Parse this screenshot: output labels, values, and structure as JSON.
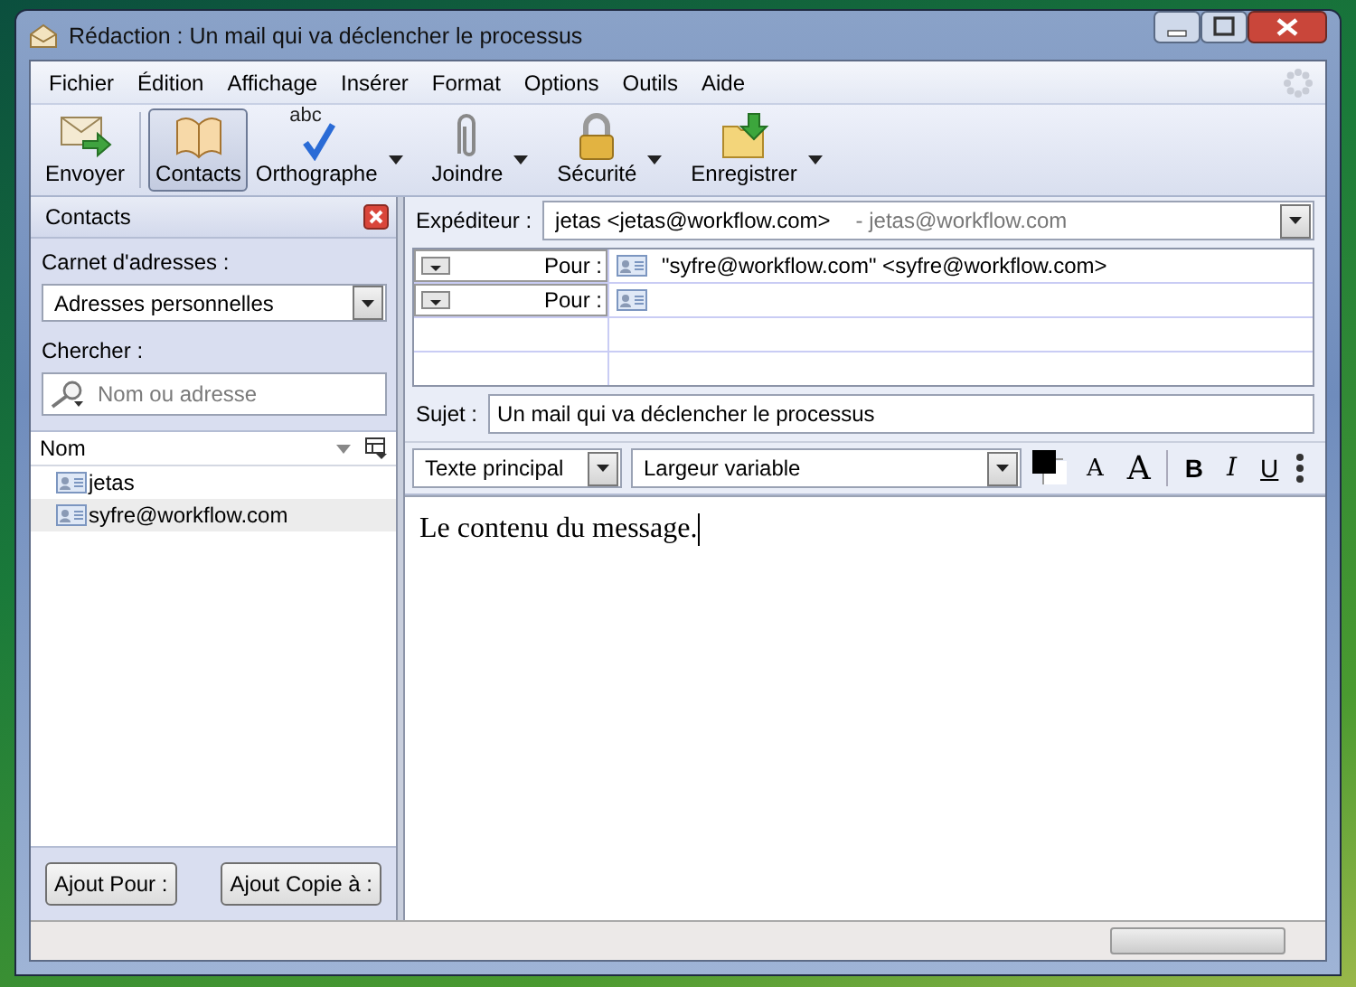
{
  "window": {
    "title": "Rédaction : Un mail qui va déclencher le processus"
  },
  "menu": [
    "Fichier",
    "Édition",
    "Affichage",
    "Insérer",
    "Format",
    "Options",
    "Outils",
    "Aide"
  ],
  "toolbar": [
    {
      "kind": "send",
      "label": "Envoyer",
      "selected": false,
      "dropdown": false
    },
    {
      "kind": "contacts",
      "label": "Contacts",
      "selected": true,
      "dropdown": false
    },
    {
      "kind": "spell",
      "label": "Orthographe",
      "icon_text": "abc",
      "selected": false,
      "dropdown": true
    },
    {
      "kind": "attach",
      "label": "Joindre",
      "selected": false,
      "dropdown": true
    },
    {
      "kind": "security",
      "label": "Sécurité",
      "selected": false,
      "dropdown": true
    },
    {
      "kind": "save",
      "label": "Enregistrer",
      "selected": false,
      "dropdown": true
    }
  ],
  "contacts_panel": {
    "title": "Contacts",
    "address_book_label": "Carnet d'adresses :",
    "address_book": "Adresses personnelles",
    "search_label": "Chercher :",
    "search": {
      "placeholder": "Nom ou adresse"
    },
    "column": "Nom",
    "contacts": [
      {
        "name": "jetas",
        "selected": false
      },
      {
        "name": "syfre@workflow.com",
        "selected": true
      }
    ],
    "buttons": [
      "Ajout Pour :",
      "Ajout Copie à :"
    ]
  },
  "compose": {
    "sender_label": "Expéditeur :",
    "sender": "jetas <jetas@workflow.com>",
    "sender_account": "- jetas@workflow.com",
    "recipients": [
      {
        "type": "Pour :",
        "address": "\"syfre@workflow.com\" <syfre@workflow.com>"
      },
      {
        "type": "Pour :"
      }
    ],
    "subject_label": "Sujet :",
    "subject": "Un mail qui va déclencher le processus"
  },
  "format_bar": {
    "paragraph_style": "Texte principal",
    "font": "Largeur variable",
    "buttons": [
      {
        "kind": "smaller",
        "label": "A"
      },
      {
        "kind": "larger",
        "label": "A"
      },
      {
        "kind": "bold",
        "label": "B"
      },
      {
        "kind": "italic",
        "label": "I"
      },
      {
        "kind": "underline",
        "label": "U"
      }
    ]
  },
  "body": "Le contenu du message.",
  "status_bar": {
    "progress": {
      "level": 0
    }
  }
}
